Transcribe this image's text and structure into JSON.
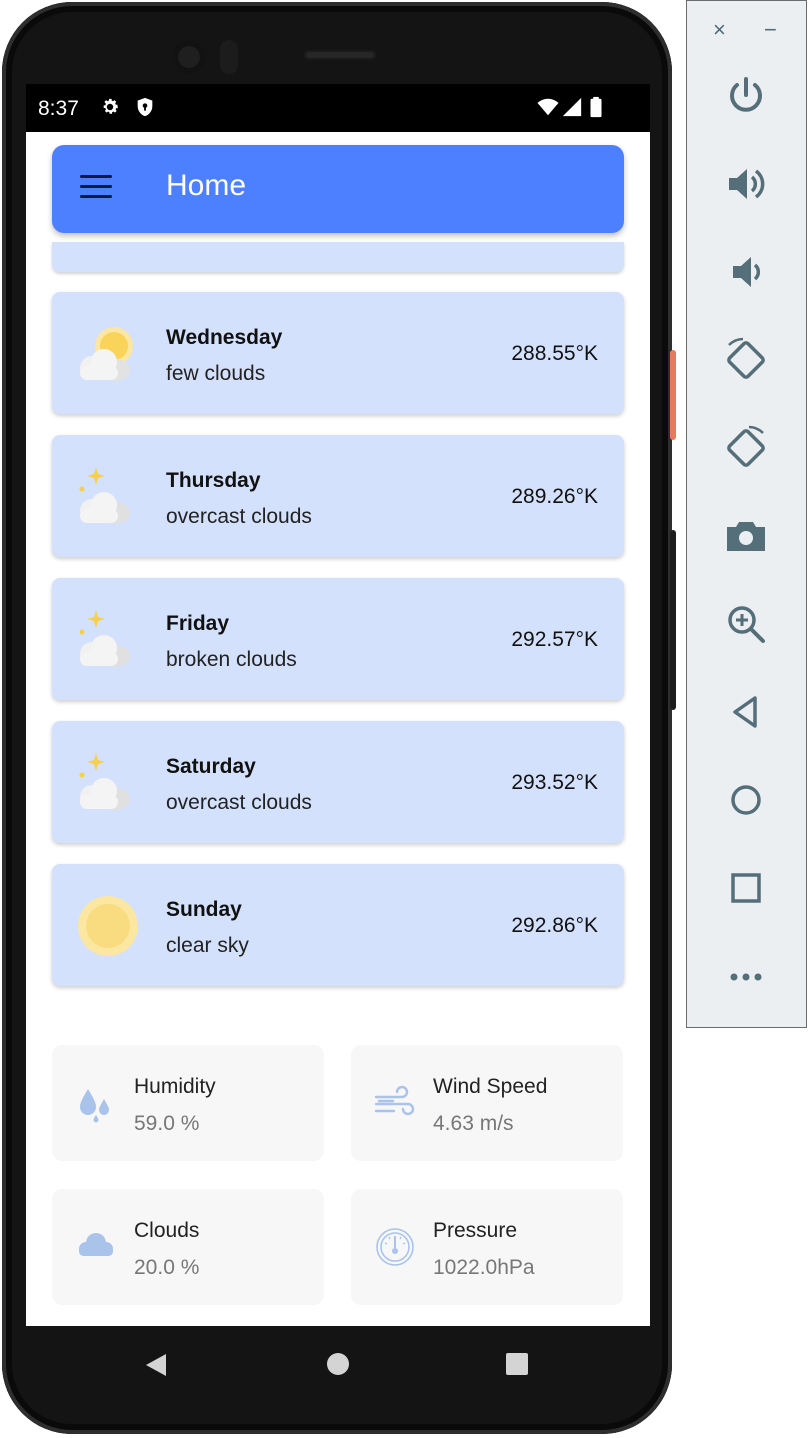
{
  "status_bar": {
    "time": "8:37",
    "icons": [
      "gear-icon",
      "shield-icon",
      "wifi-icon",
      "signal-icon",
      "battery-icon"
    ]
  },
  "app_bar": {
    "title": "Home",
    "menu_icon": "hamburger-menu-icon",
    "color": "#4c80ff"
  },
  "forecast": [
    {
      "day": "Wednesday",
      "description": "few clouds",
      "temperature": "288.55°K",
      "icon": "sun-behind-cloud-icon"
    },
    {
      "day": "Thursday",
      "description": "overcast clouds",
      "temperature": "289.26°K",
      "icon": "night-cloud-icon"
    },
    {
      "day": "Friday",
      "description": "broken clouds",
      "temperature": "292.57°K",
      "icon": "night-cloud-icon"
    },
    {
      "day": "Saturday",
      "description": "overcast clouds",
      "temperature": "293.52°K",
      "icon": "night-cloud-icon"
    },
    {
      "day": "Sunday",
      "description": "clear sky",
      "temperature": "292.86°K",
      "icon": "sun-icon"
    }
  ],
  "stats": [
    {
      "label": "Humidity",
      "value": "59.0 %",
      "icon": "water-drops-icon"
    },
    {
      "label": "Wind Speed",
      "value": "4.63 m/s",
      "icon": "wind-icon"
    },
    {
      "label": "Clouds",
      "value": "20.0 %",
      "icon": "cloud-icon"
    },
    {
      "label": "Pressure",
      "value": "1022.0hPa",
      "icon": "barometer-icon"
    }
  ],
  "nav_bar": {
    "buttons": [
      "back-triangle-icon",
      "home-circle-icon",
      "recents-square-icon"
    ]
  },
  "emulator_panel": {
    "close": "×",
    "minimize": "−",
    "tools": [
      "power-icon",
      "volume-up-icon",
      "volume-down-icon",
      "rotate-left-icon",
      "rotate-right-icon",
      "camera-icon",
      "zoom-icon",
      "back-icon",
      "home-icon",
      "overview-icon",
      "more-icon"
    ],
    "accent": "#546e7a"
  }
}
